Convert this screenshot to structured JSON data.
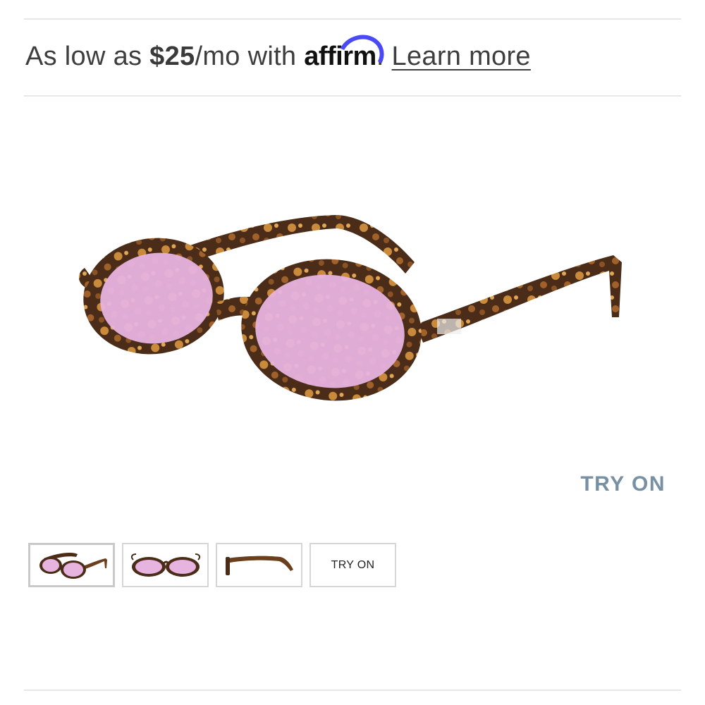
{
  "financing": {
    "prefix": "As low as ",
    "amount": "$25",
    "suffix": "/mo with ",
    "provider": "affirm",
    "period": ".",
    "link_label": "Learn more"
  },
  "product": {
    "try_on_label": "TRY ON",
    "thumbnails": [
      {
        "type": "image",
        "view": "angle"
      },
      {
        "type": "image",
        "view": "front"
      },
      {
        "type": "image",
        "view": "side"
      },
      {
        "type": "text",
        "label": "TRY ON"
      }
    ]
  },
  "colors": {
    "lens": "#e7b3df",
    "frame": "#4a2c18",
    "tortoise_light": "#c98a3c",
    "affirm_arc": "#4a4af4",
    "try_on": "#7890a3"
  }
}
